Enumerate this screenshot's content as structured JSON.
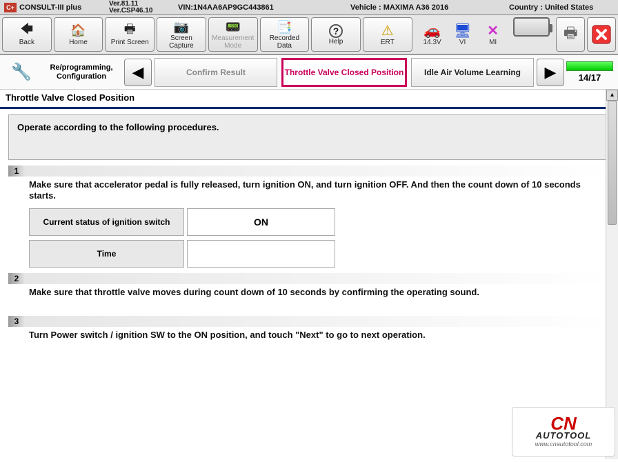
{
  "info": {
    "app_name": "CONSULT-III plus",
    "ver1": "Ver.81.11",
    "ver2": "Ver.CSP46.10",
    "vin_label": "VIN:",
    "vin": "1N4AA6AP9GC443861",
    "vehicle_label": "Vehicle :",
    "vehicle": "MAXIMA A36 2016",
    "country_label": "Country :",
    "country": "United States"
  },
  "toolbar": {
    "back": "Back",
    "home": "Home",
    "print": "Print Screen",
    "capture": "Screen Capture",
    "measure": "Measurement Mode",
    "recorded": "Recorded Data",
    "help": "Help",
    "ert": "ERT"
  },
  "status": {
    "voltage": "14.3V",
    "vi": "VI",
    "mi": "MI"
  },
  "crumb": {
    "section": "Re/programming, Configuration",
    "prev_step": "Confirm Result",
    "active_step": "Throttle Valve Closed Position",
    "next_step": "Idle Air Volume Learning",
    "progress": "14/17"
  },
  "page": {
    "title": "Throttle Valve Closed Position",
    "instruction": "Operate according to the following procedures.",
    "steps": {
      "s1_num": "1",
      "s1_text": "Make sure that accelerator pedal is fully released, turn ignition ON, and turn ignition OFF. And then the count down of 10 seconds starts.",
      "s2_num": "2",
      "s2_text": "Make sure that throttle valve moves during count down of 10 seconds by confirming the operating sound.",
      "s3_num": "3",
      "s3_text": "Turn Power switch / ignition SW to the ON position, and touch \"Next\" to go to next operation."
    },
    "kv": {
      "ign_label": "Current status of ignition switch",
      "ign_value": "ON",
      "time_label": "Time",
      "time_value": ""
    }
  },
  "watermark": {
    "cn": "CN",
    "autotool": "AUTOTOOL",
    "url": "www.cnautotool.com"
  }
}
